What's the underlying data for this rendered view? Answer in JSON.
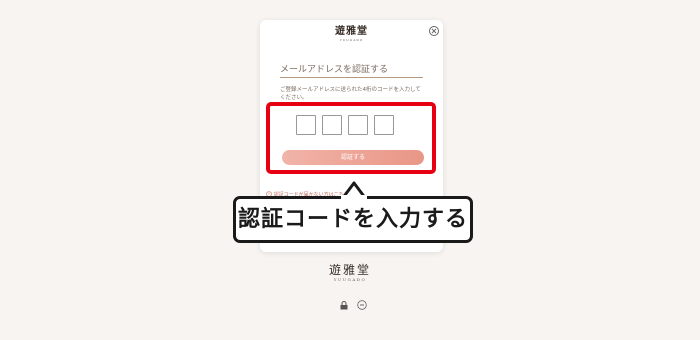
{
  "modal": {
    "logo_jp": "遊雅堂",
    "logo_en": "YUUGADO",
    "title": "メールアドレスを認証する",
    "description": "ご登録メールアドレスに送られた4桁のコードを入力してください。",
    "code_digits": [
      "",
      "",
      "",
      ""
    ],
    "submit_label": "認証する",
    "resend_text": "認証コードが届かない方はこちら"
  },
  "callout": {
    "text": "認証コードを入力する"
  },
  "footer": {
    "logo_jp": "遊雅堂",
    "logo_en": "YUUGADO"
  },
  "icons": {
    "lock": "lock-icon",
    "badge": "age-18-icon",
    "close": "close-icon",
    "info": "info-icon"
  },
  "colors": {
    "highlight": "#e60012",
    "button_start": "#f1b4a8",
    "button_end": "#e99686",
    "background": "#f7f4f1"
  }
}
